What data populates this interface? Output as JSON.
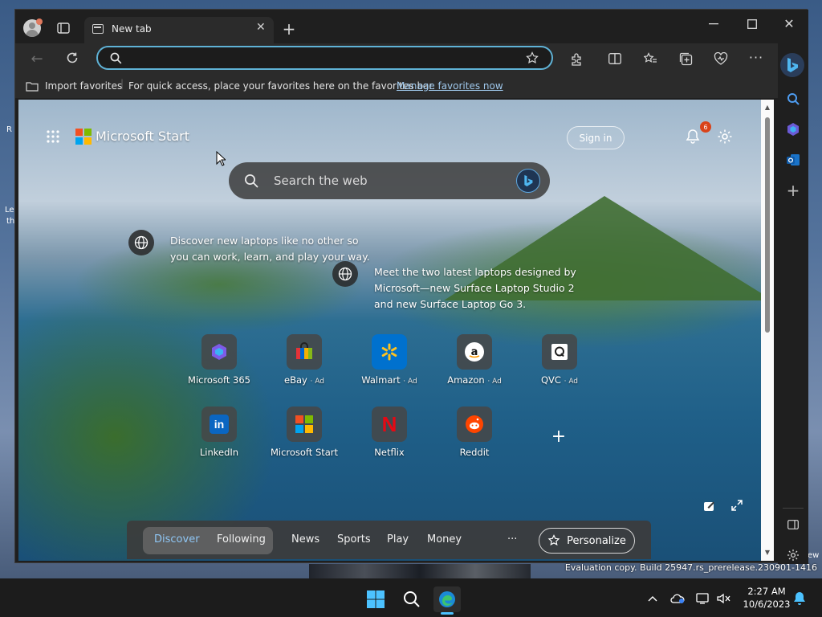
{
  "desktop": {
    "left_frag_1": "R",
    "left_frag_2": "Le",
    "left_frag_3": "th",
    "right_frag": "ew",
    "watermark": "Evaluation copy. Build 25947.rs_prerelease.230901-1416"
  },
  "browser": {
    "tab_title": "New tab",
    "address_value": "",
    "favorites_bar": {
      "import_label": "Import favorites",
      "hint": "For quick access, place your favorites here on the favorites bar.",
      "manage_link": "Manage favorites now"
    }
  },
  "newtab": {
    "brand": "Microsoft Start",
    "sign_in": "Sign in",
    "notification_count": "6",
    "search_placeholder": "Search the web",
    "promos": [
      {
        "text": "Discover new laptops like no other so you can work, learn, and play your way."
      },
      {
        "text": "Meet the two latest laptops designed by Microsoft—new Surface Laptop Studio 2 and new Surface Laptop Go 3."
      }
    ],
    "tiles_row1": [
      {
        "name": "Microsoft 365",
        "ad": ""
      },
      {
        "name": "eBay",
        "ad": "Ad"
      },
      {
        "name": "Walmart",
        "ad": "Ad"
      },
      {
        "name": "Amazon",
        "ad": "Ad"
      },
      {
        "name": "QVC",
        "ad": "Ad"
      }
    ],
    "tiles_row2": [
      {
        "name": "LinkedIn"
      },
      {
        "name": "Microsoft Start"
      },
      {
        "name": "Netflix"
      },
      {
        "name": "Reddit"
      }
    ],
    "linkedin_glyph": "in",
    "netflix_glyph": "N",
    "feed": {
      "discover": "Discover",
      "following": "Following",
      "news": "News",
      "sports": "Sports",
      "play": "Play",
      "money": "Money",
      "more": "···",
      "personalize": "Personalize"
    }
  },
  "taskbar": {
    "time": "2:27 AM",
    "date": "10/6/2023"
  },
  "colors": {
    "accent": "#5fb2d6",
    "window_bg": "#1f1f1f",
    "toolbar_bg": "#2b2b2b",
    "badge": "#d9431a"
  }
}
